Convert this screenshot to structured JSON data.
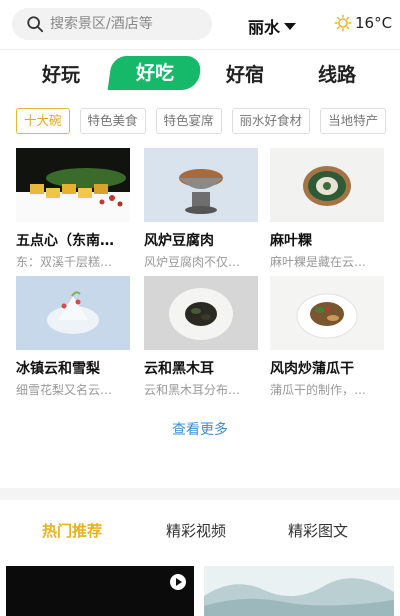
{
  "search": {
    "placeholder": "搜索景区/酒店等"
  },
  "location": {
    "city": "丽水"
  },
  "weather": {
    "temperature": "16°C",
    "icon": "sun-icon"
  },
  "category_tabs": [
    {
      "label": "好玩",
      "active": false
    },
    {
      "label": "好吃",
      "active": true
    },
    {
      "label": "好宿",
      "active": false
    },
    {
      "label": "线路",
      "active": false
    }
  ],
  "sub_tags": [
    {
      "label": "十大碗",
      "active": true
    },
    {
      "label": "特色美食",
      "active": false
    },
    {
      "label": "特色宴席",
      "active": false
    },
    {
      "label": "丽水好食材",
      "active": false
    },
    {
      "label": "当地特产",
      "active": false
    }
  ],
  "foods": [
    {
      "title": "五点心（东南…",
      "desc": "东：双溪千层糕…"
    },
    {
      "title": "风炉豆腐肉",
      "desc": "风炉豆腐肉不仅…"
    },
    {
      "title": "麻叶粿",
      "desc": "麻叶粿是藏在云…"
    },
    {
      "title": "冰镇云和雪梨",
      "desc": "细雪花梨又名云…"
    },
    {
      "title": "云和黑木耳",
      "desc": "云和黑木耳分布…"
    },
    {
      "title": "风肉炒蒲瓜干",
      "desc": "蒲瓜干的制作，…"
    }
  ],
  "more_label": "查看更多",
  "bottom_tabs": [
    {
      "label": "热门推荐",
      "active": true
    },
    {
      "label": "精彩视频",
      "active": false
    },
    {
      "label": "精彩图文",
      "active": false
    }
  ],
  "colors": {
    "accent_green": "#16b86a",
    "accent_gold": "#e8b21a",
    "link_blue": "#3a8fd8"
  }
}
